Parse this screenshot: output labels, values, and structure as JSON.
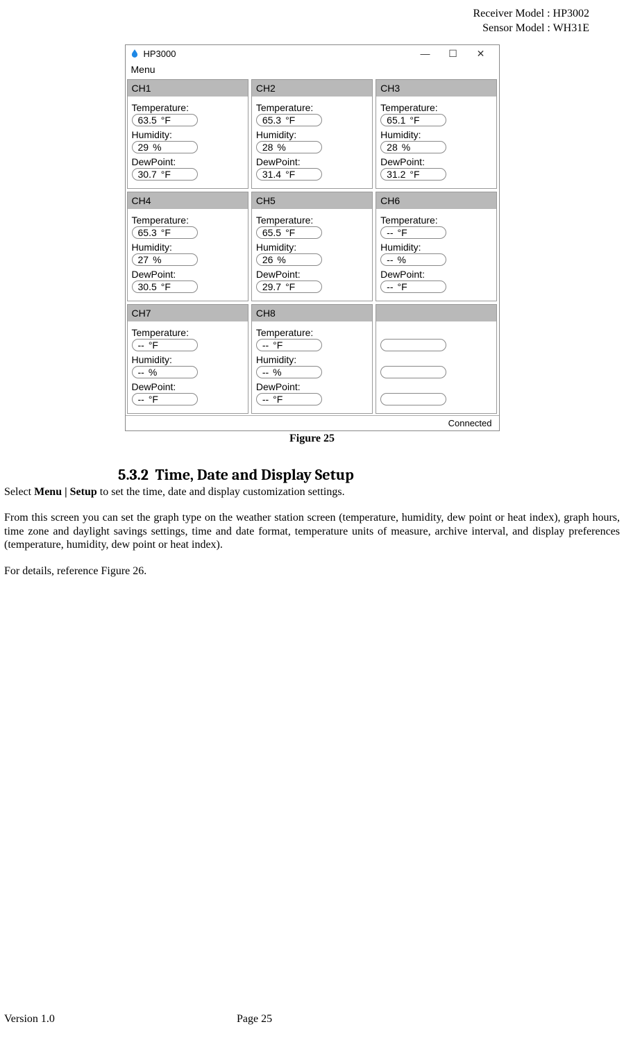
{
  "header": {
    "line1": "Receiver Model : HP3002",
    "line2": "Sensor Model : WH31E"
  },
  "window": {
    "title": "HP3000",
    "menu": "Menu",
    "minimize": "—",
    "maximize": "☐",
    "close": "✕",
    "status": "Connected"
  },
  "labels": {
    "temperature": "Temperature:",
    "humidity": "Humidity:",
    "dewpoint": "DewPoint:",
    "degF": "°F",
    "percent": "%"
  },
  "channels": [
    {
      "name": "CH1",
      "temp": "63.5",
      "hum": "29",
      "dew": "30.7"
    },
    {
      "name": "CH2",
      "temp": "65.3",
      "hum": "28",
      "dew": "31.4"
    },
    {
      "name": "CH3",
      "temp": "65.1",
      "hum": "28",
      "dew": "31.2"
    },
    {
      "name": "CH4",
      "temp": "65.3",
      "hum": "27",
      "dew": "30.5"
    },
    {
      "name": "CH5",
      "temp": "65.5",
      "hum": "26",
      "dew": "29.7"
    },
    {
      "name": "CH6",
      "temp": "--",
      "hum": "--",
      "dew": "--"
    },
    {
      "name": "CH7",
      "temp": "--",
      "hum": "--",
      "dew": "--"
    },
    {
      "name": "CH8",
      "temp": "--",
      "hum": "--",
      "dew": "--"
    },
    {
      "name": "",
      "temp": "",
      "hum": "",
      "dew": "",
      "blank": true
    }
  ],
  "caption": "Figure 25",
  "section": {
    "number": "5.3.2",
    "title": "Time, Date and Display Setup"
  },
  "para1_a": "Select ",
  "para1_b": "Menu | Setup",
  "para1_c": " to set the time, date and display customization settings.",
  "para2": "From this screen you can set the graph type on the weather station screen (temperature, humidity, dew point or heat index), graph hours, time zone and daylight savings settings, time and date format, temperature units of measure, archive interval, and display preferences (temperature, humidity, dew point or heat index).",
  "para3": "For details, reference Figure 26.",
  "footer": {
    "version": "Version 1.0",
    "page": "Page 25"
  }
}
